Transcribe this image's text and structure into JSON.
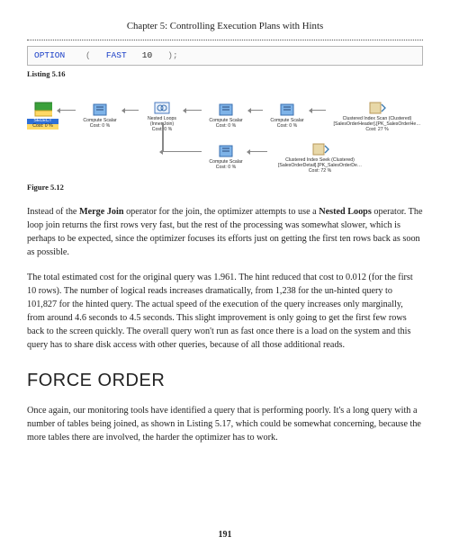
{
  "header": {
    "chapter": "Chapter 5: Controlling Execution Plans with Hints"
  },
  "code": {
    "kw_option": "OPTION",
    "paren_open": "(",
    "kw_fast": "FAST",
    "num": "10",
    "paren_close_semicolon": ");"
  },
  "labels": {
    "listing": "Listing 5.16",
    "figure": "Figure 5.12"
  },
  "diagram": {
    "select": {
      "title": "SELECT",
      "cost": "Cost: 0 %"
    },
    "cs1": {
      "title": "Compute Scalar",
      "cost": "Cost: 0 %"
    },
    "nl": {
      "title": "Nested Loops",
      "sub": "(Inner Join)",
      "cost": "Cost: 0 %"
    },
    "cs2": {
      "title": "Compute Scalar",
      "cost": "Cost: 0 %"
    },
    "cs3": {
      "title": "Compute Scalar",
      "cost": "Cost: 0 %"
    },
    "cis": {
      "title": "Clustered Index Scan (Clustered)",
      "obj": "[SalesOrderHeader].[PK_SalesOrderHe…",
      "cost": "Cost: 27 %"
    },
    "cs4": {
      "title": "Compute Scalar",
      "cost": "Cost: 0 %"
    },
    "cik": {
      "title": "Clustered Index Seek (Clustered)",
      "obj": "[SalesOrderDetail].[PK_SalesOrderDe…",
      "cost": "Cost: 72 %"
    }
  },
  "body": {
    "p1a": "Instead of the ",
    "p1b": "Merge Join",
    "p1c": " operator for the join, the optimizer attempts to use a ",
    "p1d": "Nested Loops",
    "p1e": " operator. The loop join returns the first rows very fast, but the rest of the processing was somewhat slower, which is perhaps to be expected, since the optimizer focuses its efforts just on getting the first ten rows back as soon as possible.",
    "p2": "The total estimated cost for the original query was 1.961. The hint reduced that cost to 0.012 (for the first 10 rows). The number of logical reads increases dramatically, from 1,238 for the un-hinted query to 101,827 for the hinted query. The actual speed of the execution of the query increases only marginally, from around 4.6 seconds to 4.5 seconds. This slight improvement is only going to get the first few rows back to the screen quickly. The overall query won't run as fast once there is a load on the system and this query has to share disk access with other queries, because of all those additional reads.",
    "h2": "FORCE ORDER",
    "p3": "Once again, our monitoring tools have identified a query that is performing poorly. It's a long query with a number of tables being joined, as shown in Listing 5.17, which could be somewhat concerning, because the more tables there are involved, the harder the optimizer has to work."
  },
  "page": "191"
}
